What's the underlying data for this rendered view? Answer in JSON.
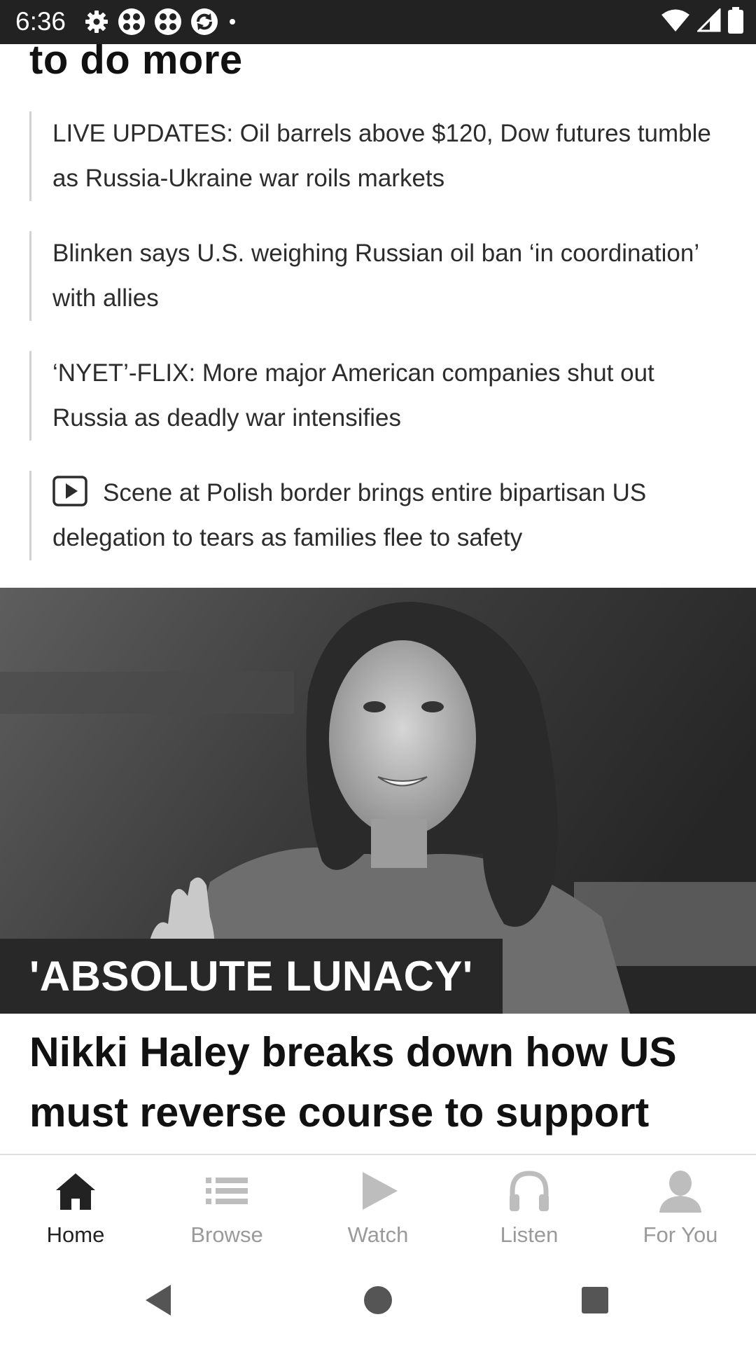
{
  "status_bar": {
    "time": "6:36",
    "icons_left": [
      "gear-icon",
      "app-grid-icon",
      "app-grid-icon",
      "sync-icon",
      "dot-icon"
    ],
    "icons_right": [
      "wifi-icon",
      "signal-icon",
      "battery-icon"
    ]
  },
  "article_list": {
    "previous_headline_fragment": "to do more",
    "related_links": [
      {
        "text": "LIVE UPDATES: Oil barrels above $120, Dow futures tumble as Russia-Ukraine war roils markets",
        "has_video": false
      },
      {
        "text": "Blinken says U.S. weighing Russian oil ban ‘in coordination’ with allies",
        "has_video": false
      },
      {
        "text": "‘NYET’-FLIX: More major American companies shut out Russia as deadly war intensifies",
        "has_video": false
      },
      {
        "text": "Scene at Polish border brings entire bipartisan US delegation to tears as families flee to safety",
        "has_video": true
      }
    ]
  },
  "featured_story": {
    "image_label": "'ABSOLUTE LUNACY'",
    "headline": "Nikki Haley breaks down how US must reverse course to support"
  },
  "bottom_nav": {
    "active": "Home",
    "items": [
      {
        "label": "Home",
        "icon": "home-icon"
      },
      {
        "label": "Browse",
        "icon": "list-icon"
      },
      {
        "label": "Watch",
        "icon": "play-icon"
      },
      {
        "label": "Listen",
        "icon": "headphones-icon"
      },
      {
        "label": "For You",
        "icon": "person-icon"
      }
    ]
  },
  "system_nav": {
    "icons": [
      "back-icon",
      "home-circle-icon",
      "recents-icon"
    ]
  },
  "colors": {
    "status_bar_bg": "#222222",
    "nav_active": "#222222",
    "nav_inactive": "#9a9a9a",
    "label_bg": "#282828"
  }
}
